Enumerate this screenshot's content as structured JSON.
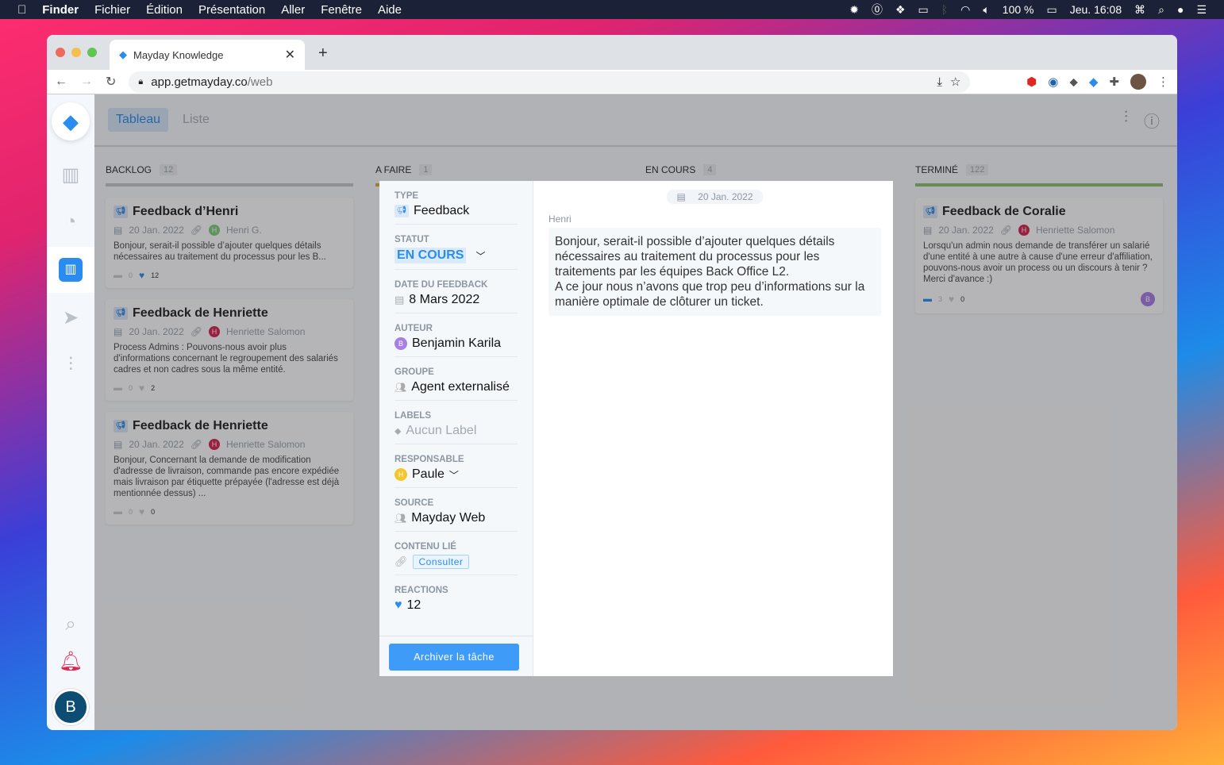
{
  "menubar": {
    "app": "Finder",
    "items": [
      "Fichier",
      "Édition",
      "Présentation",
      "Aller",
      "Fenêtre",
      "Aide"
    ],
    "battery": "100 %",
    "clock": "Jeu. 16:08"
  },
  "browser": {
    "tab_title": "Mayday Knowledge",
    "url_host": "app.getmayday.co",
    "url_path": "/web"
  },
  "views": {
    "board": "Tableau",
    "list": "Liste"
  },
  "columns": [
    {
      "title": "BACKLOG",
      "count": "12",
      "color": "#c8c8c8",
      "cards": [
        {
          "title": "Feedback d’Henri",
          "date": "20 Jan. 2022",
          "author": "Henri G.",
          "author_initial": "H",
          "author_color": "#7ed07a",
          "text": "Bonjour, serait-il possible d’ajouter quelques détails nécessaires au traitement du processus pour les B...",
          "comments": "0",
          "likes": "12"
        },
        {
          "title": "Feedback de Henriette",
          "date": "20 Jan. 2022",
          "author": "Henriette Salomon",
          "author_initial": "H",
          "author_color": "#d8204f",
          "text": "Process Admins : Pouvons-nous avoir plus d'informations concernant le regroupement des salariés cadres et non cadres sous la même entité.",
          "comments": "0",
          "likes": "2"
        },
        {
          "title": "Feedback de Henriette",
          "date": "20 Jan. 2022",
          "author": "Henriette Salomon",
          "author_initial": "H",
          "author_color": "#d8204f",
          "text": "Bonjour, Concernant la demande de modification d'adresse de livraison, commande pas encore expédiée mais livraison par étiquette prépayée (l'adresse est déjà mentionnée dessus) ...",
          "comments": "0",
          "likes": "0"
        }
      ]
    },
    {
      "title": "A FAIRE",
      "count": "1",
      "color": "#e0a93a",
      "cards": []
    },
    {
      "title": "EN COURS",
      "count": "4",
      "color": "#3e9cf8",
      "cards": []
    },
    {
      "title": "TERMINÉ",
      "count": "122",
      "color": "#8fbf6e",
      "cards": [
        {
          "title": "Feedback de Coralie",
          "date": "20 Jan. 2022",
          "author": "Henriette Salomon",
          "author_initial": "H",
          "author_color": "#d8204f",
          "text": "Lorsqu'un admin nous demande de transférer un salarié d'une entité à une autre à cause d'une erreur d'affiliation, pouvons-nous avoir un process ou un discours à tenir ? Merci d'avance :)",
          "comments": "3",
          "likes": "0",
          "assignee_initial": "B"
        }
      ]
    }
  ],
  "modal": {
    "type_label": "TYPE",
    "type": "Feedback",
    "status_label": "STATUT",
    "status": "EN COURS",
    "date_label": "DATE DU FEEDBACK",
    "date": "8 Mars 2022",
    "author_label": "AUTEUR",
    "author": "Benjamin Karila",
    "author_initial": "B",
    "group_label": "GROUPE",
    "group": "Agent externalisé",
    "labels_label": "LABELS",
    "labels": "Aucun Label",
    "owner_label": "RESPONSABLE",
    "owner": "Paule",
    "owner_initial": "H",
    "source_label": "SOURCE",
    "source": "Mayday Web",
    "linked_label": "CONTENU LIÉ",
    "linked_button": "Consulter",
    "reactions_label": "REACTIONS",
    "reactions": "12",
    "archive_button": "Archiver la tâche",
    "message_date": "20 Jan. 2022",
    "message_author": "Henri",
    "message": "Bonjour, serait-il possible d’ajouter quelques détails nécessaires au traitement du processus pour les traitements par les équipes Back Office L2.\nA ce jour nous n’avons que trop peu d’informations sur la manière optimale de clôturer un ticket."
  },
  "user_initial": "B",
  "colors": {
    "accent": "#2a8cf0",
    "archive": "#3e9cf8"
  }
}
